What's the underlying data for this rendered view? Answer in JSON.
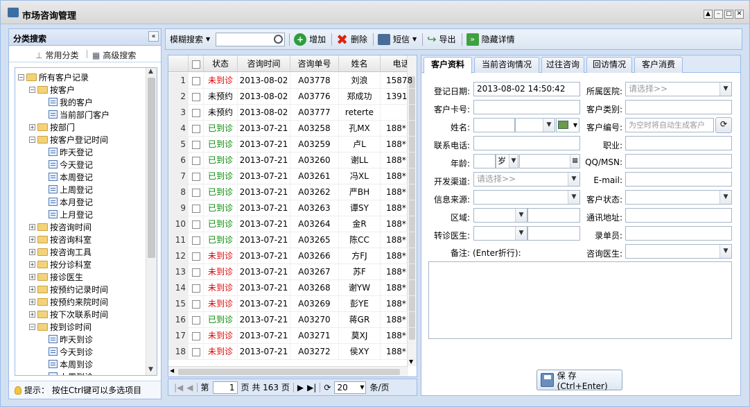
{
  "window": {
    "title": "市场咨询管理"
  },
  "left": {
    "title": "分类搜索",
    "tab_common": "常用分类",
    "tab_advanced": "高级搜索",
    "tip": "提示：  按住Ctrl键可以多选项目",
    "tree": [
      {
        "label": "所有客户记录",
        "level": 0,
        "type": "folder",
        "exp": "minus"
      },
      {
        "label": "按客户",
        "level": 1,
        "type": "folder",
        "exp": "minus"
      },
      {
        "label": "我的客户",
        "level": 2,
        "type": "leaf"
      },
      {
        "label": "当前部门客户",
        "level": 2,
        "type": "leaf"
      },
      {
        "label": "按部门",
        "level": 1,
        "type": "folder",
        "exp": "plus"
      },
      {
        "label": "按客户登记时间",
        "level": 1,
        "type": "folder",
        "exp": "minus"
      },
      {
        "label": "昨天登记",
        "level": 2,
        "type": "leaf"
      },
      {
        "label": "今天登记",
        "level": 2,
        "type": "leaf"
      },
      {
        "label": "本周登记",
        "level": 2,
        "type": "leaf"
      },
      {
        "label": "上周登记",
        "level": 2,
        "type": "leaf"
      },
      {
        "label": "本月登记",
        "level": 2,
        "type": "leaf"
      },
      {
        "label": "上月登记",
        "level": 2,
        "type": "leaf"
      },
      {
        "label": "按咨询时间",
        "level": 1,
        "type": "folder",
        "exp": "plus"
      },
      {
        "label": "按咨询科室",
        "level": 1,
        "type": "folder",
        "exp": "plus"
      },
      {
        "label": "按咨询工具",
        "level": 1,
        "type": "folder",
        "exp": "plus"
      },
      {
        "label": "按分诊科室",
        "level": 1,
        "type": "folder",
        "exp": "plus"
      },
      {
        "label": "接诊医生",
        "level": 1,
        "type": "folder",
        "exp": "plus"
      },
      {
        "label": "按预约记录时间",
        "level": 1,
        "type": "folder",
        "exp": "plus"
      },
      {
        "label": "按预约来院时间",
        "level": 1,
        "type": "folder",
        "exp": "plus"
      },
      {
        "label": "按下次联系时间",
        "level": 1,
        "type": "folder",
        "exp": "plus"
      },
      {
        "label": "按到诊时间",
        "level": 1,
        "type": "folder",
        "exp": "minus"
      },
      {
        "label": "昨天到诊",
        "level": 2,
        "type": "leaf"
      },
      {
        "label": "今天到诊",
        "level": 2,
        "type": "leaf"
      },
      {
        "label": "本周到诊",
        "level": 2,
        "type": "leaf"
      },
      {
        "label": "上周到诊",
        "level": 2,
        "type": "leaf"
      }
    ]
  },
  "toolbar": {
    "fuzzy": "模糊搜索",
    "add": "增加",
    "delete": "删除",
    "sms": "短信",
    "export": "导出",
    "hide": "隐藏详情",
    "search_value": ""
  },
  "grid": {
    "headers": [
      "状态",
      "咨询时间",
      "咨询单号",
      "姓名",
      "电话"
    ],
    "rows": [
      {
        "n": "1",
        "status": "未到诊",
        "sc": "red",
        "time": "2013-08-02",
        "no": "A03778",
        "name": "刘浪",
        "phone": "15878"
      },
      {
        "n": "2",
        "status": "未预约",
        "sc": "black",
        "time": "2013-08-02",
        "no": "A03776",
        "name": "郑成功",
        "phone": "1391"
      },
      {
        "n": "3",
        "status": "未预约",
        "sc": "black",
        "time": "2013-08-02",
        "no": "A03777",
        "name": "reterte",
        "phone": ""
      },
      {
        "n": "4",
        "status": "已到诊",
        "sc": "green",
        "time": "2013-07-21",
        "no": "A03258",
        "name": "孔MX",
        "phone": "188*"
      },
      {
        "n": "5",
        "status": "已到诊",
        "sc": "green",
        "time": "2013-07-21",
        "no": "A03259",
        "name": "卢L",
        "phone": "188*"
      },
      {
        "n": "6",
        "status": "已到诊",
        "sc": "green",
        "time": "2013-07-21",
        "no": "A03260",
        "name": "谢LL",
        "phone": "188*"
      },
      {
        "n": "7",
        "status": "已到诊",
        "sc": "green",
        "time": "2013-07-21",
        "no": "A03261",
        "name": "冯XL",
        "phone": "188*"
      },
      {
        "n": "8",
        "status": "已到诊",
        "sc": "green",
        "time": "2013-07-21",
        "no": "A03262",
        "name": "严BH",
        "phone": "188*"
      },
      {
        "n": "9",
        "status": "已到诊",
        "sc": "green",
        "time": "2013-07-21",
        "no": "A03263",
        "name": "谭SY",
        "phone": "188*"
      },
      {
        "n": "10",
        "status": "已到诊",
        "sc": "green",
        "time": "2013-07-21",
        "no": "A03264",
        "name": "金R",
        "phone": "188*"
      },
      {
        "n": "11",
        "status": "已到诊",
        "sc": "green",
        "time": "2013-07-21",
        "no": "A03265",
        "name": "陈CC",
        "phone": "188*"
      },
      {
        "n": "12",
        "status": "未到诊",
        "sc": "red",
        "time": "2013-07-21",
        "no": "A03266",
        "name": "方FJ",
        "phone": "188*"
      },
      {
        "n": "13",
        "status": "未到诊",
        "sc": "red",
        "time": "2013-07-21",
        "no": "A03267",
        "name": "苏F",
        "phone": "188*"
      },
      {
        "n": "14",
        "status": "未到诊",
        "sc": "red",
        "time": "2013-07-21",
        "no": "A03268",
        "name": "谢YW",
        "phone": "188*"
      },
      {
        "n": "15",
        "status": "未到诊",
        "sc": "red",
        "time": "2013-07-21",
        "no": "A03269",
        "name": "彭YE",
        "phone": "188*"
      },
      {
        "n": "16",
        "status": "已到诊",
        "sc": "green",
        "time": "2013-07-21",
        "no": "A03270",
        "name": "蒋GR",
        "phone": "188*"
      },
      {
        "n": "17",
        "status": "未到诊",
        "sc": "red",
        "time": "2013-07-21",
        "no": "A03271",
        "name": "莫XJ",
        "phone": "188*"
      },
      {
        "n": "18",
        "status": "未到诊",
        "sc": "red",
        "time": "2013-07-21",
        "no": "A03272",
        "name": "侯XY",
        "phone": "188*"
      }
    ]
  },
  "pager": {
    "page_label": "第",
    "page": "1",
    "total": "页 共 163 页",
    "size": "20",
    "per": "条/页"
  },
  "form": {
    "tabs": [
      "客户资料",
      "当前咨询情况",
      "过往咨询",
      "回访情况",
      "客户消费"
    ],
    "labels": {
      "reg_date": "登记日期:",
      "card": "客户卡号:",
      "name": "姓名:",
      "phone": "联系电话:",
      "age": "年龄:",
      "channel": "开发渠道:",
      "source": "信息来源:",
      "area": "区域:",
      "doctor2": "转诊医生:",
      "remark": "备注:",
      "remark_hint": "(Enter折行):",
      "hospital": "所属医院:",
      "category": "客户类别:",
      "custno": "客户编号:",
      "job": "职业:",
      "qq": "QQ/MSN:",
      "email": "E-mail:",
      "status": "客户状态:",
      "address": "通讯地址:",
      "recorder": "录单员:",
      "cdoctor": "咨询医生:"
    },
    "values": {
      "reg_date": "2013-08-02 14:50:42",
      "age_unit": "岁"
    },
    "placeholders": {
      "select": "请选择>>",
      "custno": "为空时将自动生成客户"
    },
    "save": "保 存(Ctrl+Enter)"
  }
}
